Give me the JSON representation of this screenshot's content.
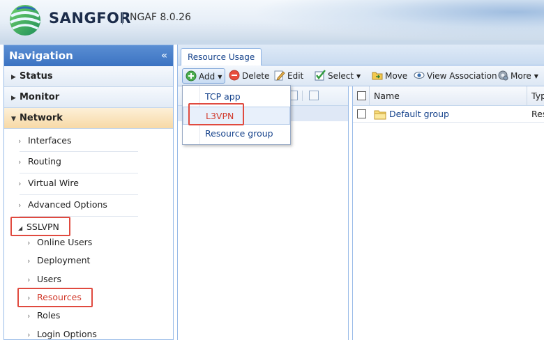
{
  "header": {
    "brand": "SANGFOR",
    "version": "NGAF 8.0.26"
  },
  "nav": {
    "title": "Navigation",
    "collapse_glyph": "«",
    "sections": [
      {
        "label": "Status",
        "expanded": false
      },
      {
        "label": "Monitor",
        "expanded": false
      },
      {
        "label": "Network",
        "expanded": true
      }
    ],
    "network_items": [
      "Interfaces",
      "Routing",
      "Virtual Wire",
      "Advanced Options"
    ],
    "sslvpn": {
      "label": "SSLVPN",
      "items": [
        "Online Users",
        "Deployment",
        "Users",
        "Resources",
        "Roles",
        "Login Options"
      ],
      "selected": "Resources"
    }
  },
  "main": {
    "tab": "Resource Usage",
    "toolbar": {
      "add": "Add",
      "delete": "Delete",
      "edit": "Edit",
      "select": "Select",
      "move": "Move",
      "view_association": "View Association",
      "more": "More"
    },
    "add_menu": [
      "TCP app",
      "L3VPN",
      "Resource group"
    ],
    "add_menu_highlighted": "L3VPN",
    "grid": {
      "columns": [
        "Name",
        "Typ"
      ],
      "rows": [
        {
          "name": "Default group",
          "type": "Res"
        }
      ]
    }
  },
  "colors": {
    "nav_header": "#3b73c2",
    "highlight_box": "#e04a3f",
    "link": "#15428b",
    "active_section": "#f7d9a6"
  },
  "icons": {
    "add": "plus-circle-icon",
    "delete": "minus-circle-icon",
    "edit": "pencil-icon",
    "select": "check-icon",
    "move": "folder-move-icon",
    "view_association": "eye-icon",
    "more": "gear-icon",
    "group": "folder-icon"
  }
}
